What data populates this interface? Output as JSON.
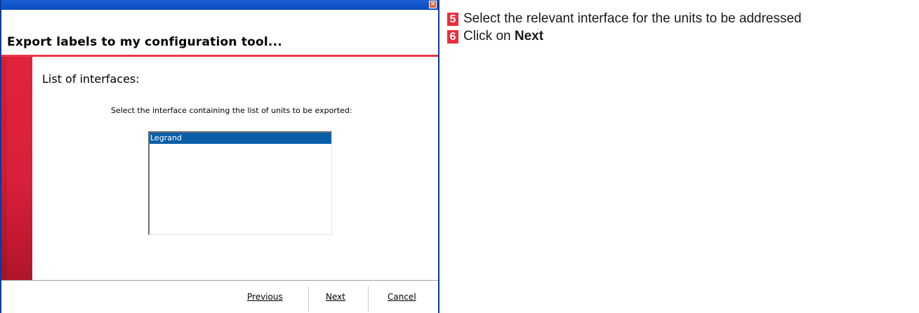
{
  "dialog": {
    "header_title": "Export labels to my configuration tool...",
    "section_title": "List of interfaces:",
    "instructions": "Select the interface containing the list of units to be exported:",
    "close_glyph": "×",
    "list": {
      "items": [
        {
          "label": "Legrand",
          "selected": true
        }
      ]
    },
    "buttons": {
      "previous": "Previous",
      "next": "Next",
      "cancel": "Cancel"
    }
  },
  "steps": [
    {
      "number": "5",
      "text": "Select the relevant interface for the units to be addressed",
      "bold": ""
    },
    {
      "number": "6",
      "text": "Click on ",
      "bold": "Next"
    }
  ],
  "colors": {
    "accent_red": "#e8303e",
    "titlebar_blue": "#0b4bbf",
    "selection_blue": "#0b5fa8"
  }
}
